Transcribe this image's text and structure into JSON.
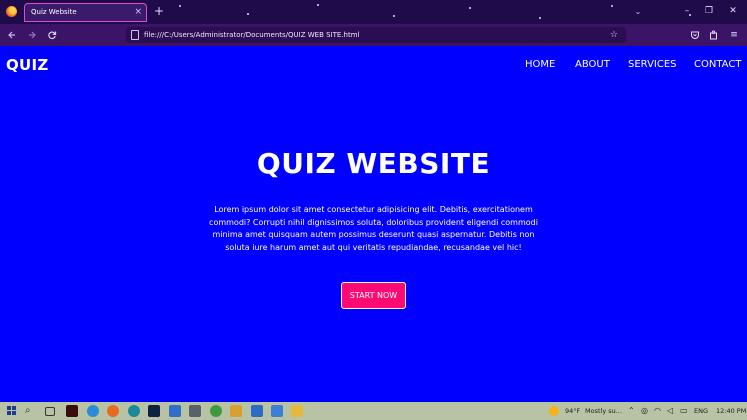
{
  "browser": {
    "tab_title": "Quiz Website",
    "tab_close": "×",
    "new_tab": "+",
    "tab_list": "⌄",
    "url": "file:///C:/Users/Administrator/Documents/QUIZ WEB SITE.html",
    "window_controls": {
      "minimize": "–",
      "maximize": "❐",
      "close": "✕"
    }
  },
  "site": {
    "logo": "QUIZ",
    "menu": [
      "HOME",
      "ABOUT",
      "SERVICES",
      "CONTACT"
    ]
  },
  "hero": {
    "title": "QUIZ WEBSITE",
    "text": "Lorem ipsum dolor sit amet consectetur adipisicing elit. Debitis, exercitationem commodi? Corrupti nihil dignissimos soluta, doloribus provident eligendi commodi minima amet quisquam autem possimus deserunt quasi aspernatur. Debitis non soluta iure harum amet aut qui veritatis repudiandae, recusandae vel hic!",
    "button": "START NOW"
  },
  "taskbar": {
    "weather": "94°F",
    "weather_status": "Mostly su...",
    "language": "ENG",
    "time": "12:40 PM"
  },
  "colors": {
    "page_background": "#0000ff",
    "button": "#ff0a74",
    "browser_frame": "#3b1468"
  }
}
